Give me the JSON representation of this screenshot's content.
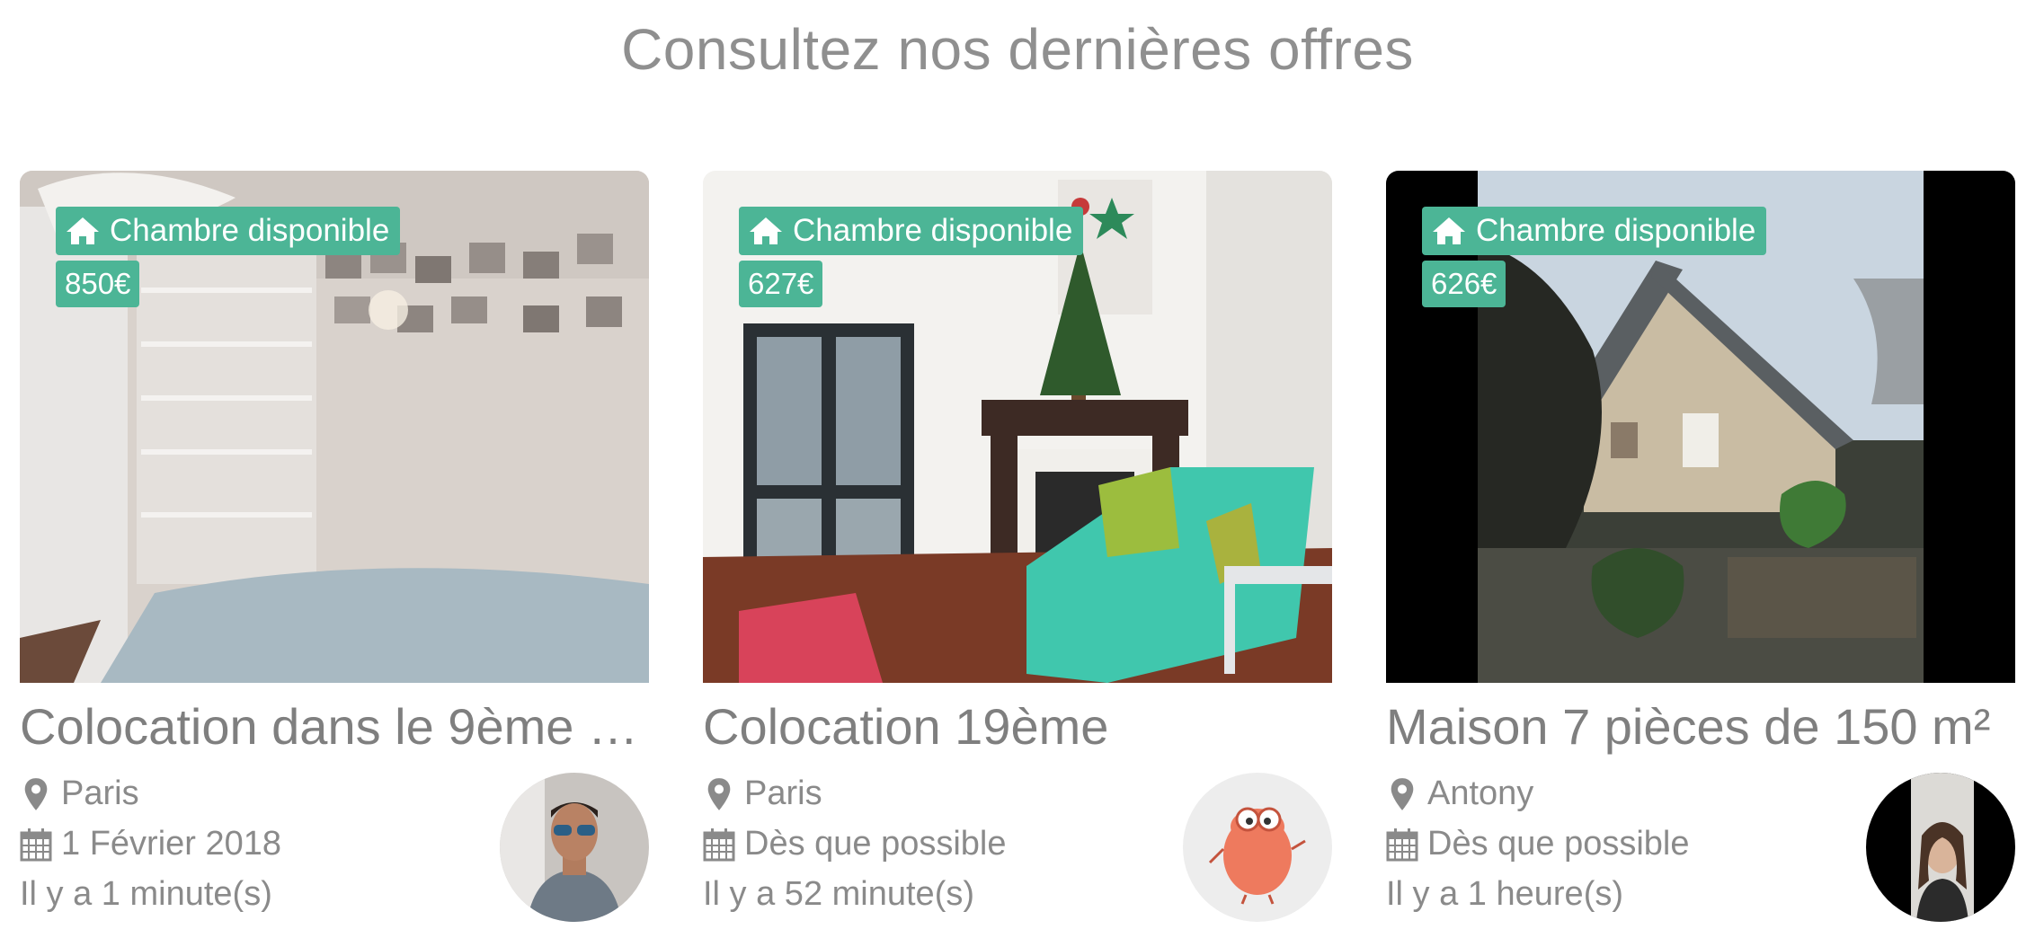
{
  "section": {
    "title": "Consultez nos dernières offres"
  },
  "colors": {
    "accent": "#4cb596",
    "text": "#8a8a8a"
  },
  "icons": {
    "badge": "home-icon",
    "location": "map-marker-icon",
    "date": "calendar-icon"
  },
  "offers": [
    {
      "badge": "Chambre disponible",
      "price": "850€",
      "title": "Colocation dans le 9ème …",
      "location": "Paris",
      "availability": "1 Février 2018",
      "posted": "Il y a 1 minute(s)"
    },
    {
      "badge": "Chambre disponible",
      "price": "627€",
      "title": "Colocation 19ème",
      "location": "Paris",
      "availability": "Dès que possible",
      "posted": "Il y a 52 minute(s)"
    },
    {
      "badge": "Chambre disponible",
      "price": "626€",
      "title": "Maison 7 pièces de 150 m²",
      "location": "Antony",
      "availability": "Dès que possible",
      "posted": "Il y a 1 heure(s)"
    }
  ]
}
